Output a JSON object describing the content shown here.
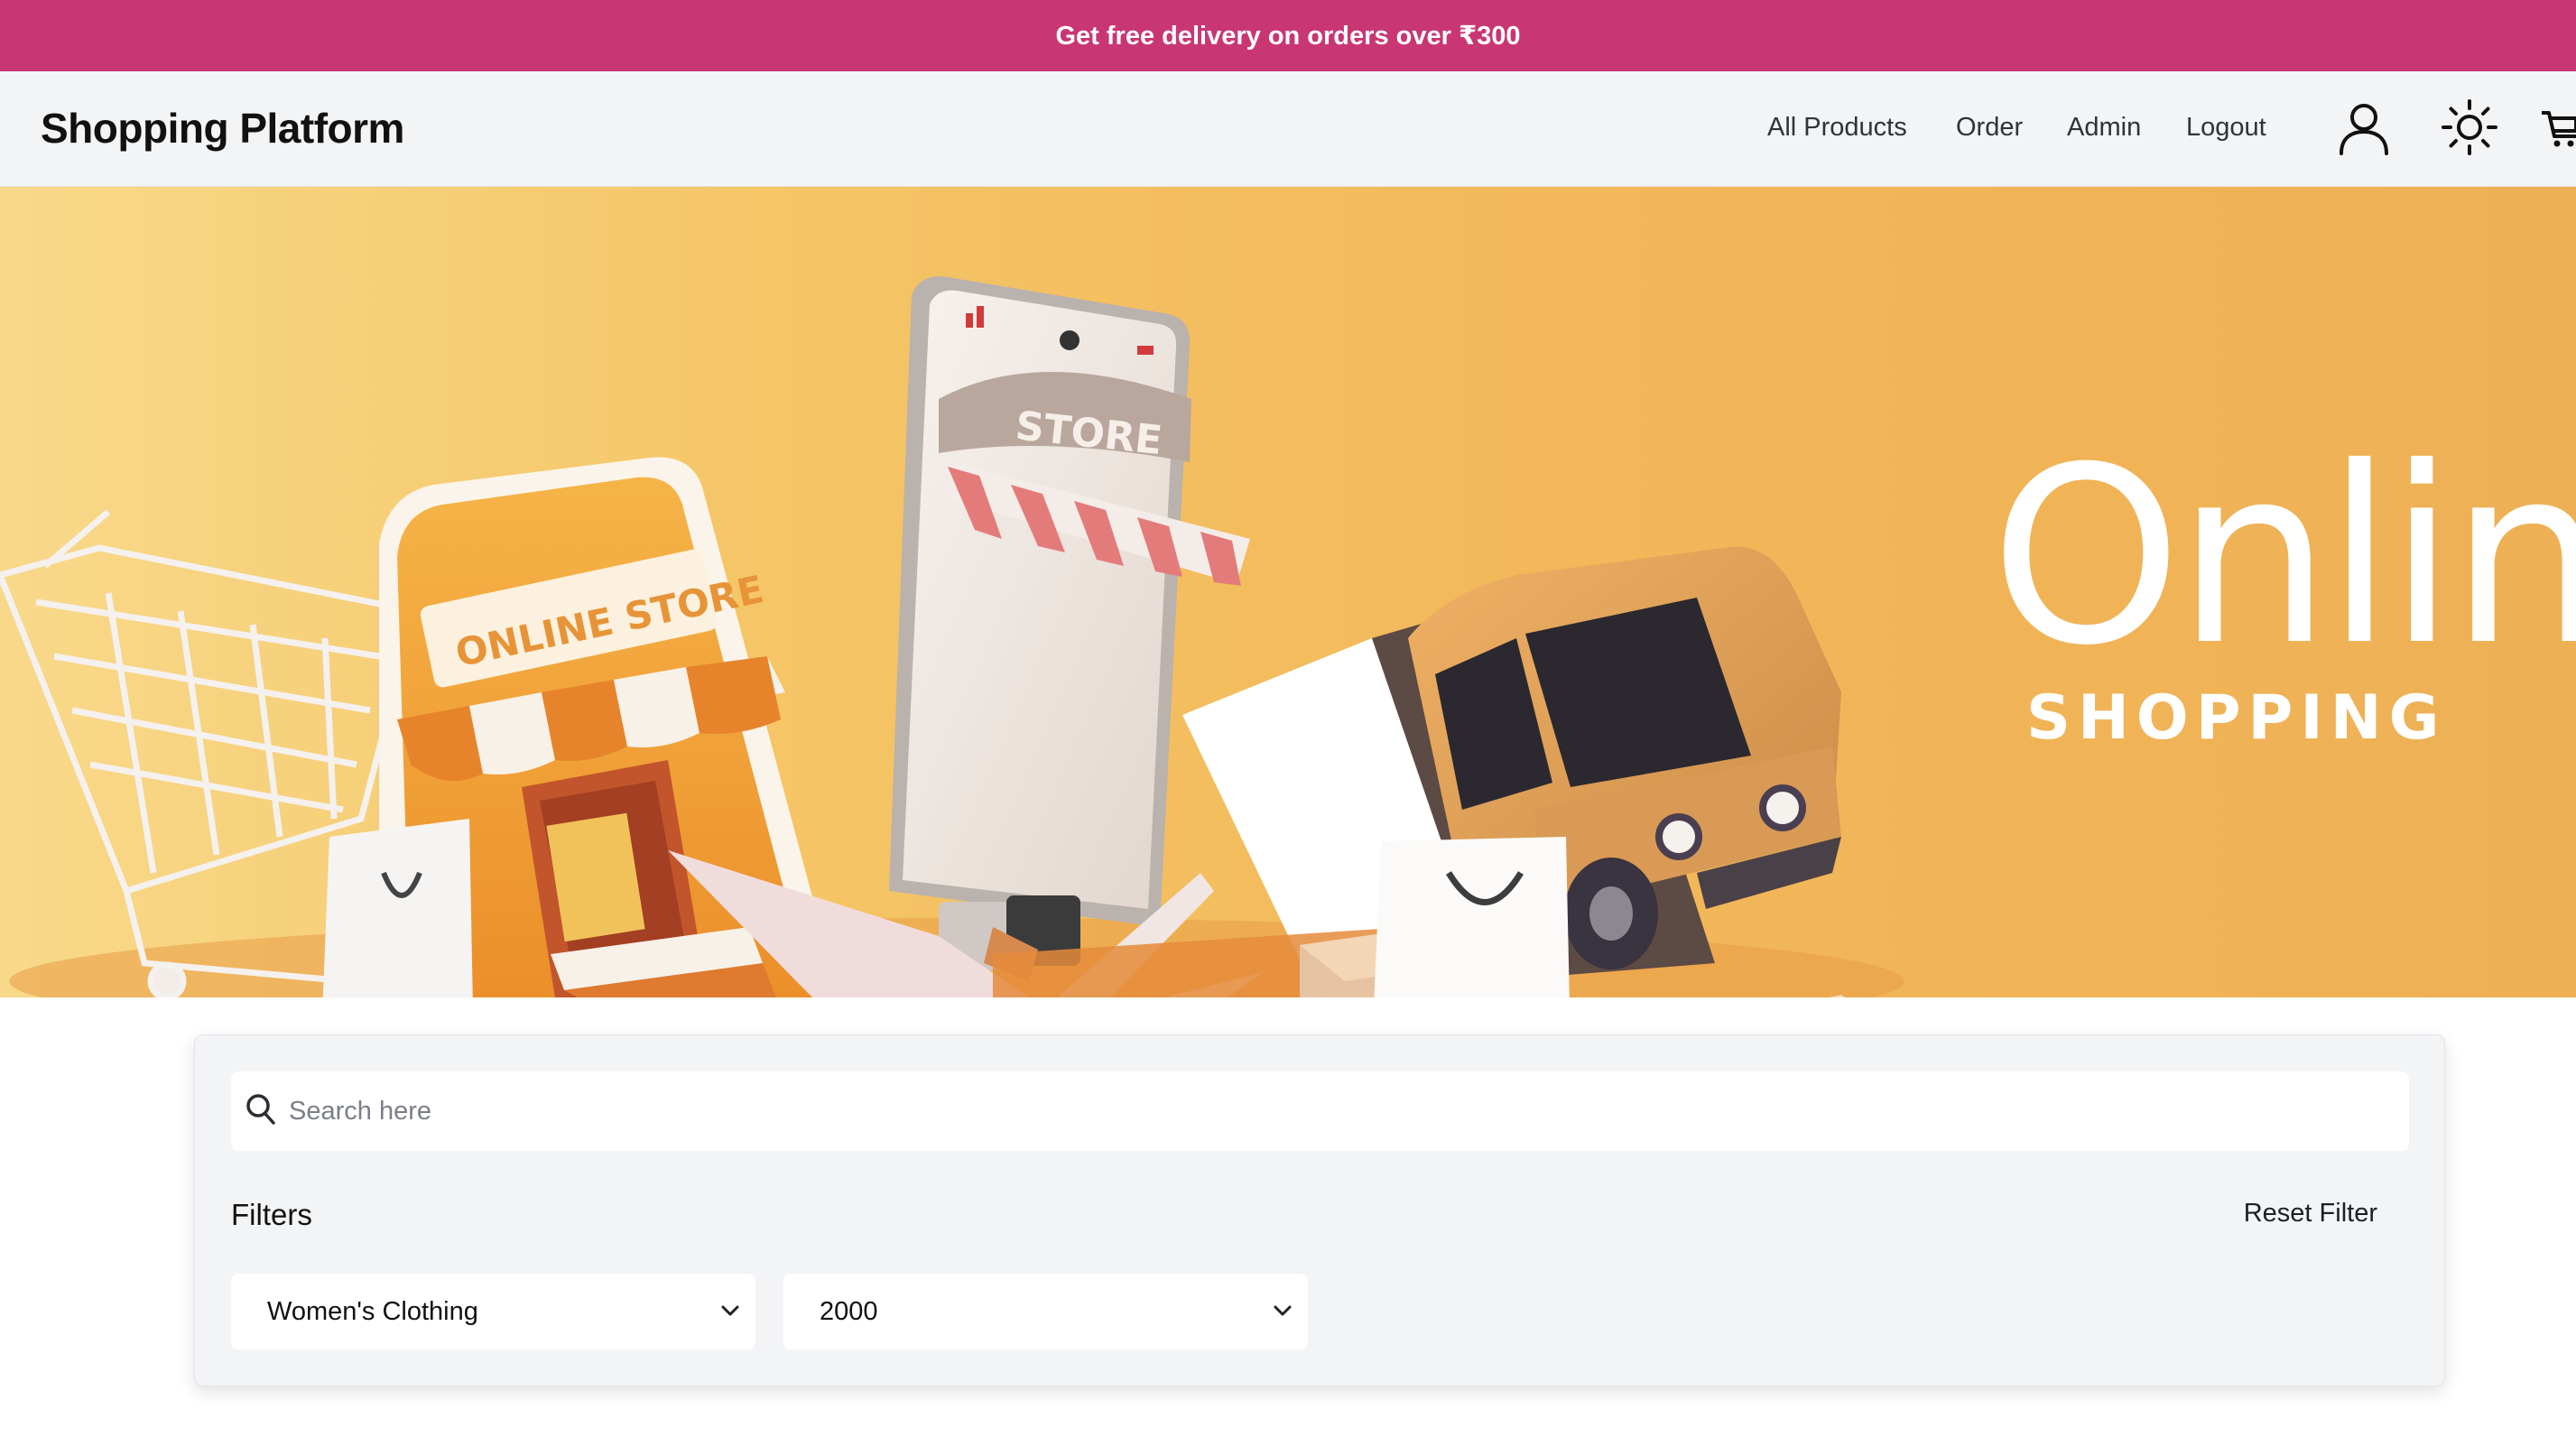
{
  "promo": {
    "text": "Get free delivery on orders over ₹300"
  },
  "header": {
    "brand": "Shopping Platform",
    "nav": [
      {
        "label": "All Products"
      },
      {
        "label": "Order"
      },
      {
        "label": "Admin"
      },
      {
        "label": "Logout"
      }
    ],
    "icons": [
      "user-icon",
      "sun-icon",
      "cart-icon"
    ]
  },
  "hero": {
    "title": "Online.",
    "subtitle": "SHOPPING",
    "store_sign": "ONLINE STORE",
    "phone_sign": "STORE"
  },
  "filters": {
    "search_placeholder": "Search here",
    "search_value": "",
    "label": "Filters",
    "reset_label": "Reset Filter",
    "category": {
      "selected": "Women's Clothing"
    },
    "price": {
      "selected": "2000"
    }
  },
  "colors": {
    "promo_bg": "#c93674",
    "header_bg": "#f3f4f6",
    "hero_bg": "#f2b859",
    "panel_bg": "#f3f4f6"
  }
}
